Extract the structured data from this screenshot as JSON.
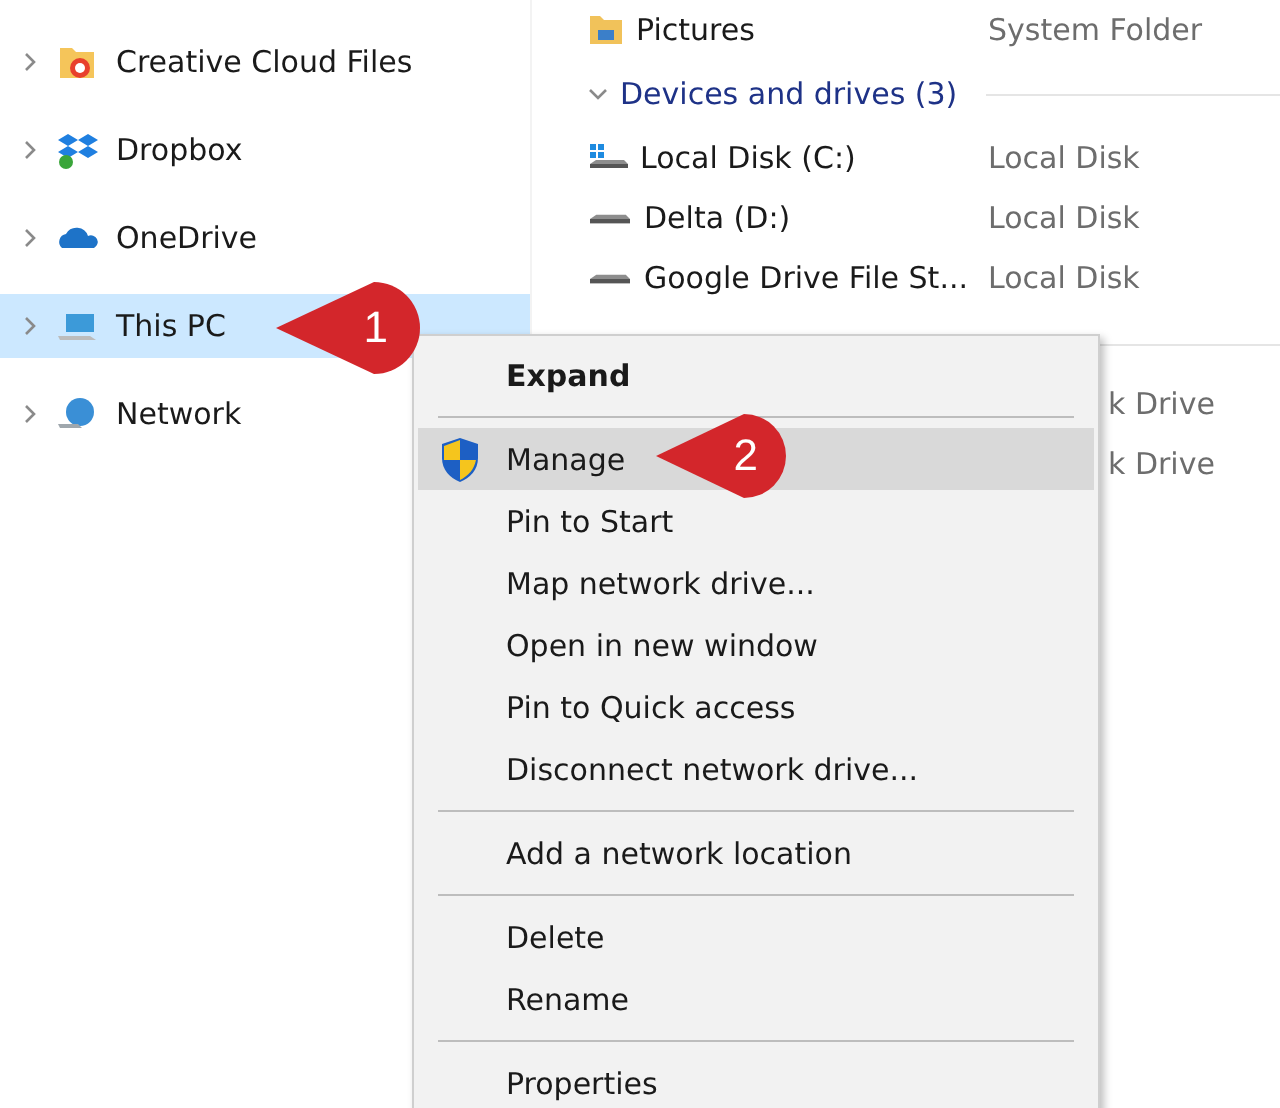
{
  "navigation_pane": {
    "items": [
      {
        "label": "Creative Cloud Files",
        "kind": "cloud-folder",
        "selected": false
      },
      {
        "label": "Dropbox",
        "kind": "dropbox",
        "selected": false
      },
      {
        "label": "OneDrive",
        "kind": "onedrive",
        "selected": false
      },
      {
        "label": "This PC",
        "kind": "pc",
        "selected": true
      },
      {
        "label": "Network",
        "kind": "network",
        "selected": false
      }
    ]
  },
  "content": {
    "top_row": {
      "name": "Pictures",
      "type": "System Folder"
    },
    "group": {
      "label": "Devices and drives (3)",
      "expanded": true
    },
    "drives": [
      {
        "name": "Local Disk (C:)",
        "type": "Local Disk",
        "kind": "system"
      },
      {
        "name": "Delta (D:)",
        "type": "Local Disk",
        "kind": "drive"
      },
      {
        "name": "Google Drive File St...",
        "type": "Local Disk",
        "kind": "drive"
      }
    ],
    "covered_rows": [
      {
        "type": "k Drive"
      },
      {
        "type": "k Drive"
      }
    ]
  },
  "context_menu": {
    "items": [
      {
        "label": "Expand",
        "kind": "default",
        "highlighted": false
      },
      {
        "kind": "separator"
      },
      {
        "label": "Manage",
        "kind": "shield",
        "highlighted": true
      },
      {
        "label": "Pin to Start",
        "kind": "item",
        "highlighted": false
      },
      {
        "label": "Map network drive...",
        "kind": "item",
        "highlighted": false
      },
      {
        "label": "Open in new window",
        "kind": "item",
        "highlighted": false
      },
      {
        "label": "Pin to Quick access",
        "kind": "item",
        "highlighted": false
      },
      {
        "label": "Disconnect network drive...",
        "kind": "item",
        "highlighted": false
      },
      {
        "kind": "separator"
      },
      {
        "label": "Add a network location",
        "kind": "item",
        "highlighted": false
      },
      {
        "kind": "separator"
      },
      {
        "label": "Delete",
        "kind": "item",
        "highlighted": false
      },
      {
        "label": "Rename",
        "kind": "item",
        "highlighted": false
      },
      {
        "kind": "separator"
      },
      {
        "label": "Properties",
        "kind": "item",
        "highlighted": false
      }
    ]
  },
  "callouts": [
    {
      "number": "1"
    },
    {
      "number": "2"
    }
  ]
}
